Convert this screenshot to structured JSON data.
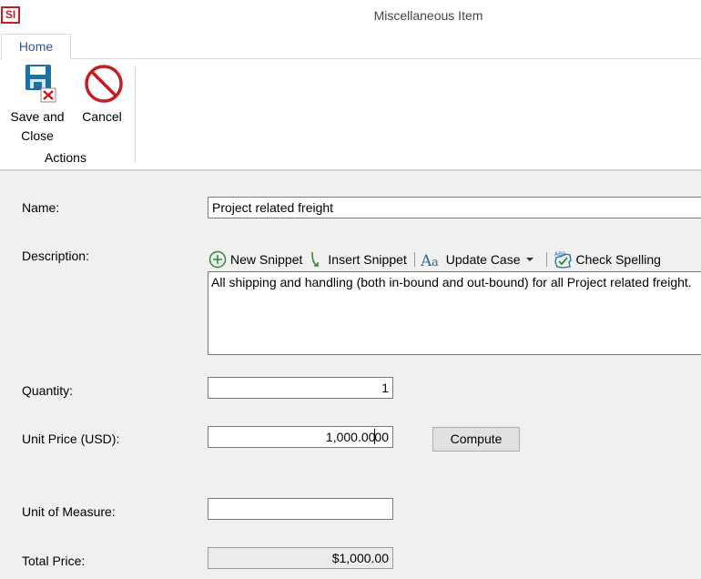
{
  "app": {
    "logo_text": "SI",
    "window_title": "Miscellaneous Item"
  },
  "ribbon": {
    "tabs": [
      "Home"
    ],
    "save_close_label_line1": "Save and",
    "save_close_label_line2": "Close",
    "cancel_label": "Cancel",
    "group_label": "Actions"
  },
  "form": {
    "name_label": "Name:",
    "name_value": "Project related freight",
    "description_label": "Description:",
    "snippet_toolbar": {
      "new_snippet": "New Snippet",
      "insert_snippet": "Insert Snippet",
      "update_case": "Update Case",
      "check_spelling": "Check Spelling"
    },
    "description_value": "All shipping and handling (both in-bound and out-bound) for all Project related freight.",
    "quantity_label": "Quantity:",
    "quantity_value": "1",
    "unit_price_label": "Unit Price (USD):",
    "unit_price_value_before_caret": "1,000.00",
    "unit_price_value_after_caret": "00",
    "compute_label": "Compute",
    "unit_of_measure_label": "Unit of Measure:",
    "unit_of_measure_value": "",
    "total_price_label": "Total Price:",
    "total_price_value": "$1,000.00"
  },
  "colors": {
    "brand_red": "#c41e24",
    "tab_blue": "#2b579a",
    "icon_blue": "#1f6fa3",
    "snippet_green": "#2e8b3a"
  }
}
